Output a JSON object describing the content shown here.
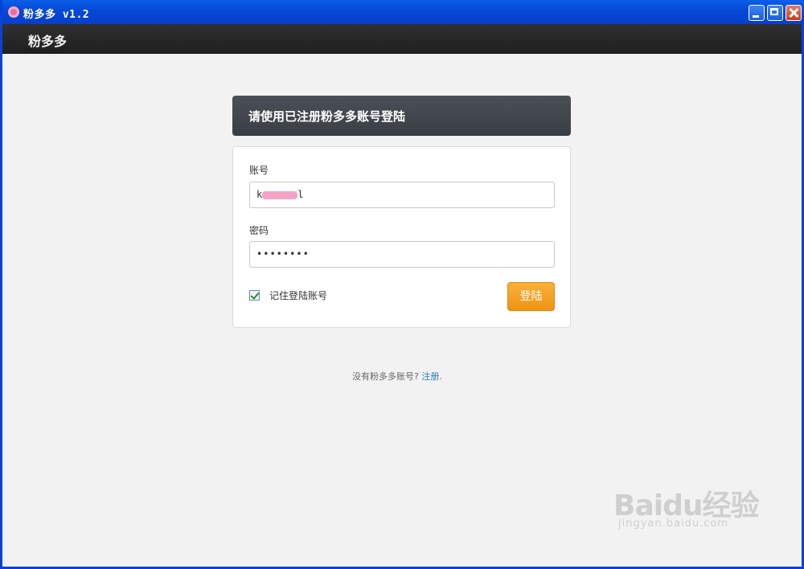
{
  "window": {
    "title": "粉多多 v1.2"
  },
  "header": {
    "brand": "粉多多"
  },
  "login": {
    "heading": "请使用已注册粉多多账号登陆",
    "account_label": "账号",
    "account_value": "k",
    "account_value_end": "l",
    "password_label": "密码",
    "password_value": "••••••••",
    "remember_label": "记住登陆账号",
    "remember_checked": true,
    "submit_label": "登陆"
  },
  "footer": {
    "prompt": "没有粉多多账号?",
    "register_link": "注册",
    "trailing": "."
  },
  "watermark": {
    "brand": "Baidu经验",
    "url": "jingyan.baidu.com"
  }
}
